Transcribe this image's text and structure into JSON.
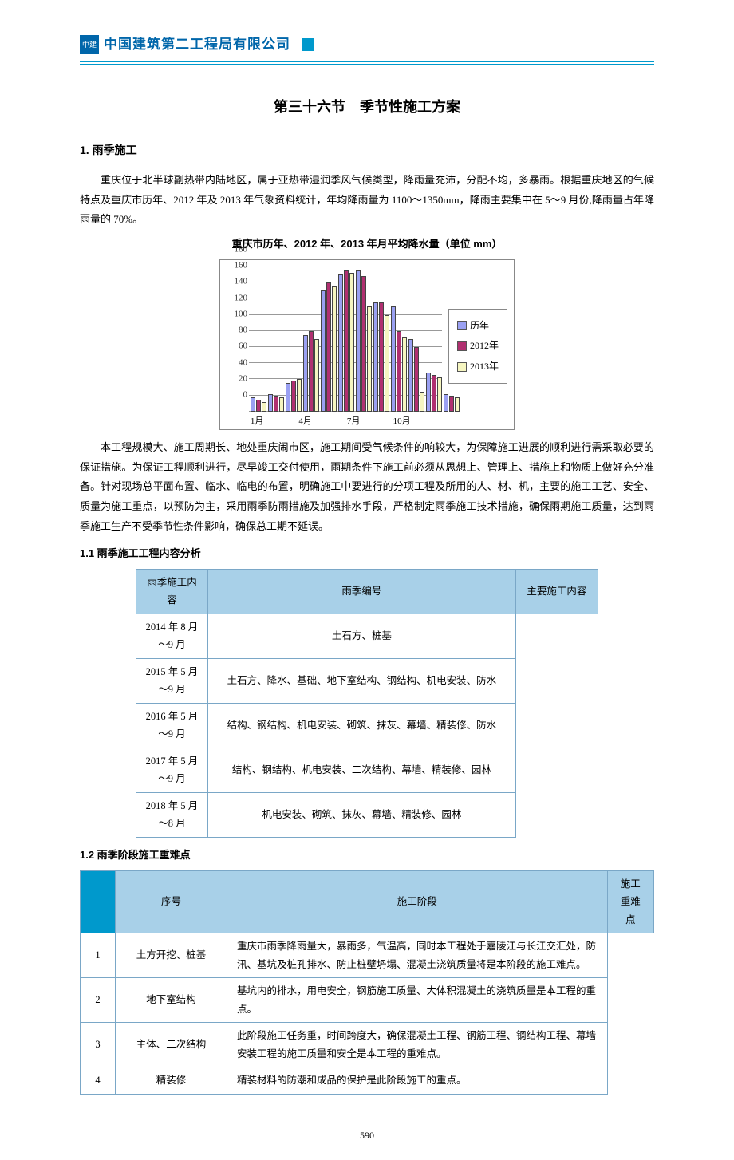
{
  "header": {
    "company": "中国建筑第二工程局有限公司"
  },
  "title": "第三十六节　季节性施工方案",
  "section1": {
    "heading": "1.  雨季施工"
  },
  "para1": "重庆位于北半球副热带内陆地区，属于亚热带湿润季风气候类型，降雨量充沛，分配不均，多暴雨。根据重庆地区的气候特点及重庆市历年、2012 年及 2013 年气象资料统计，年均降雨量为 1100～1350mm，降雨主要集中在 5～9 月份,降雨量占年降雨量的 70%。",
  "chart_title": "重庆市历年、2012 年、2013 年月平均降水量（单位 mm）",
  "chart_data": {
    "type": "bar",
    "categories": [
      "1月",
      "2月",
      "3月",
      "4月",
      "5月",
      "6月",
      "7月",
      "8月",
      "9月",
      "10月",
      "11月",
      "12月"
    ],
    "series": [
      {
        "name": "历年",
        "values": [
          18,
          22,
          35,
          95,
          150,
          170,
          175,
          135,
          130,
          90,
          48,
          22
        ]
      },
      {
        "name": "2012年",
        "values": [
          15,
          20,
          38,
          100,
          160,
          175,
          168,
          135,
          100,
          80,
          45,
          20
        ]
      },
      {
        "name": "2013年",
        "values": [
          12,
          18,
          40,
          90,
          155,
          172,
          130,
          120,
          92,
          25,
          42,
          18
        ]
      }
    ],
    "ylim": [
      0,
      180
    ],
    "ystep": 20,
    "xticks_shown": [
      "1月",
      "4月",
      "7月",
      "10月"
    ],
    "xlabel": "",
    "ylabel": "",
    "title": ""
  },
  "para2": "本工程规模大、施工周期长、地处重庆闹市区，施工期间受气候条件的响较大，为保障施工进展的顺利进行需采取必要的保证措施。为保证工程顺利进行，尽早竣工交付使用，雨期条件下施工前必须从思想上、管理上、措施上和物质上做好充分准备。针对现场总平面布置、临水、临电的布置，明确施工中要进行的分项工程及所用的人、材、机，主要的施工工艺、安全、质量为施工重点，以预防为主，采用雨季防雨措施及加强排水手段，严格制定雨季施工技术措施，确保雨期施工质量，达到雨季施工生产不受季节性条件影响，确保总工期不延误。",
  "sec11": {
    "heading": "1.1  雨季施工工程内容分析"
  },
  "table1": {
    "rowlabel": "雨季施工内容",
    "h1": "雨季编号",
    "h2": "主要施工内容",
    "rows": [
      {
        "period": "2014 年 8 月～9 月",
        "content": "土石方、桩基"
      },
      {
        "period": "2015 年 5 月～9 月",
        "content": "土石方、降水、基础、地下室结构、钢结构、机电安装、防水"
      },
      {
        "period": "2016 年 5 月～9 月",
        "content": "结构、钢结构、机电安装、砌筑、抹灰、幕墙、精装修、防水"
      },
      {
        "period": "2017 年 5 月～9 月",
        "content": "结构、钢结构、机电安装、二次结构、幕墙、精装修、园林"
      },
      {
        "period": "2018 年 5 月～8 月",
        "content": "机电安装、砌筑、抹灰、幕墙、精装修、园林"
      }
    ]
  },
  "sec12": {
    "heading": "1.2  雨季阶段施工重难点"
  },
  "table2": {
    "h1": "序号",
    "h2": "施工阶段",
    "h3": "施工重难点",
    "rows": [
      {
        "seq": "1",
        "phase": "土方开挖、桩基",
        "desc": "重庆市雨季降雨量大，暴雨多，气温高，同时本工程处于嘉陵江与长江交汇处，防汛、基坑及桩孔排水、防止桩壁坍塌、混凝土浇筑质量将是本阶段的施工难点。"
      },
      {
        "seq": "2",
        "phase": "地下室结构",
        "desc": "基坑内的排水，用电安全，钢筋施工质量、大体积混凝土的浇筑质量是本工程的重点。"
      },
      {
        "seq": "3",
        "phase": "主体、二次结构",
        "desc": "此阶段施工任务重，时间跨度大，确保混凝土工程、钢筋工程、钢结构工程、幕墙安装工程的施工质量和安全是本工程的重难点。"
      },
      {
        "seq": "4",
        "phase": "精装修",
        "desc": "精装材料的防潮和成品的保护是此阶段施工的重点。"
      }
    ]
  },
  "page_num": "590"
}
